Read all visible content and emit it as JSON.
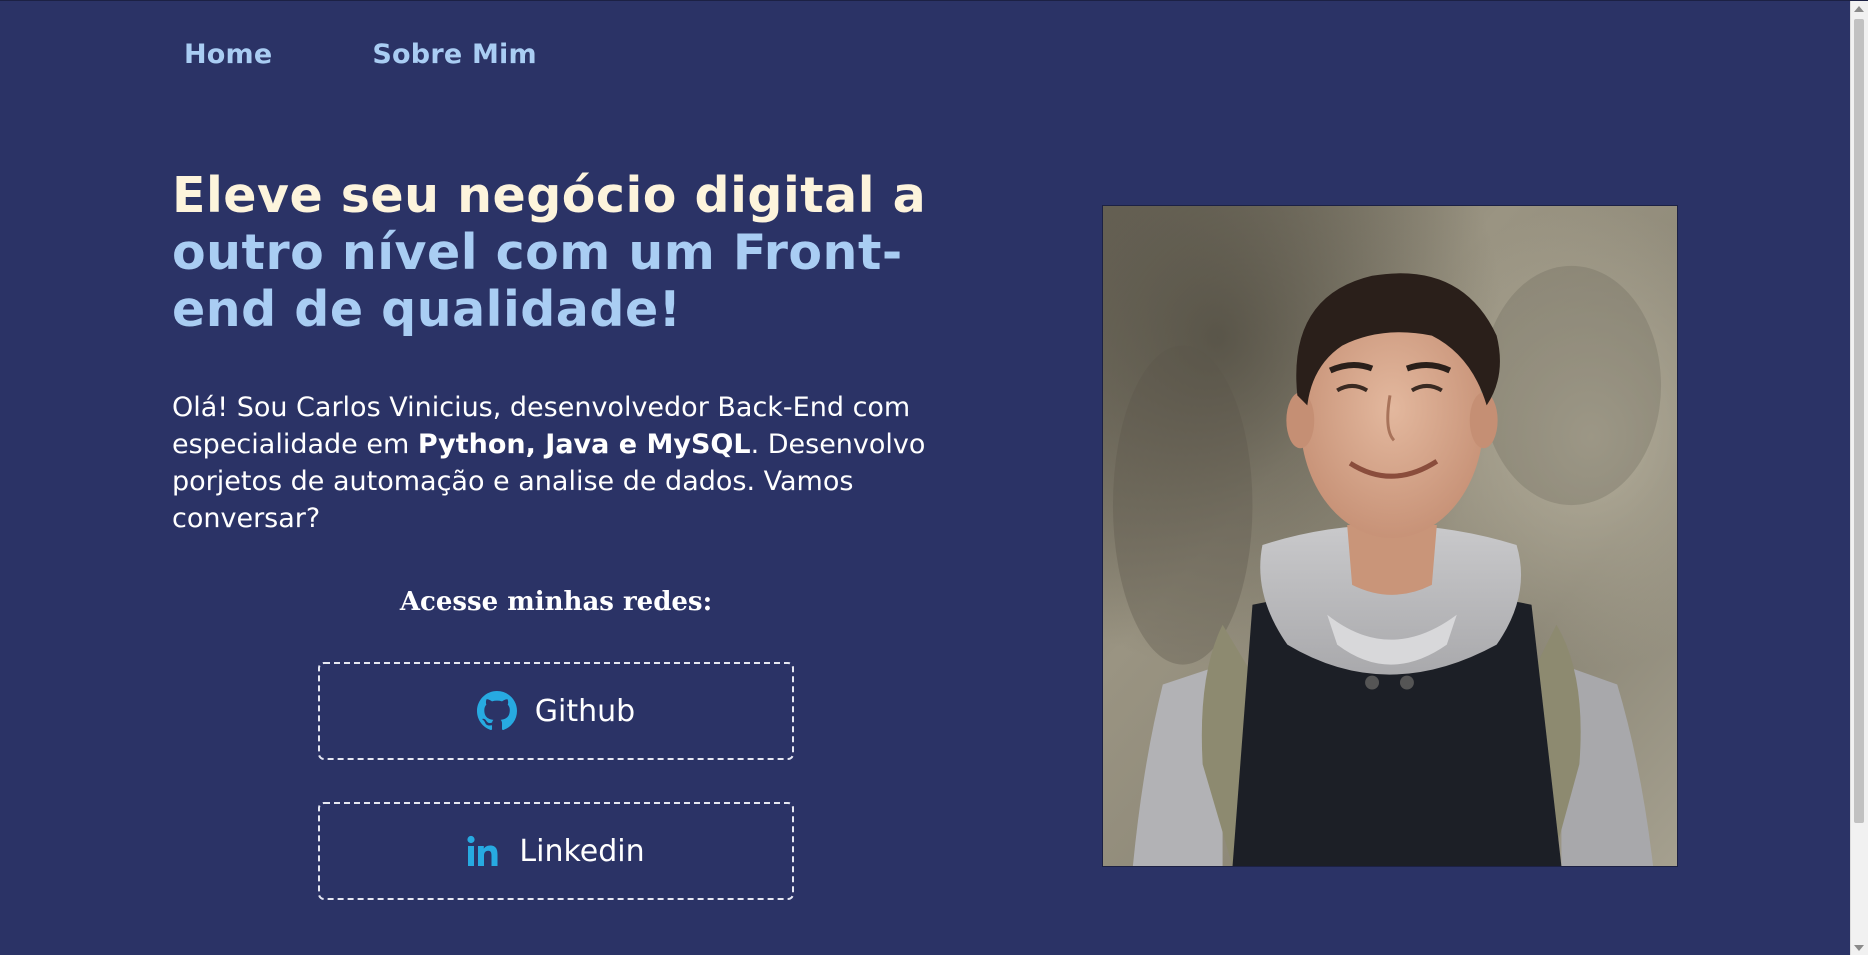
{
  "nav": {
    "items": [
      {
        "label": "Home"
      },
      {
        "label": "Sobre Mim"
      }
    ]
  },
  "hero": {
    "headline_part1": "Eleve seu negócio digital a ",
    "headline_part2": "outro nível com um Front-end de qualidade!",
    "intro_part1": "Olá! Sou Carlos Vinicius, desenvolvedor Back-End com especialidade em ",
    "intro_bold": "Python, Java e MySQL",
    "intro_part2": ". Desenvolvo porjetos de automação e analise de dados. Vamos conversar?"
  },
  "networks": {
    "title": "Acesse minhas redes:",
    "github_label": "Github",
    "linkedin_label": "Linkedin"
  },
  "icons": {
    "github": "github-icon",
    "linkedin": "linkedin-icon"
  },
  "colors": {
    "background": "#2b3366",
    "accent": "#a9cdf3",
    "headline": "#fdf4dc",
    "icon": "#27aae1"
  }
}
